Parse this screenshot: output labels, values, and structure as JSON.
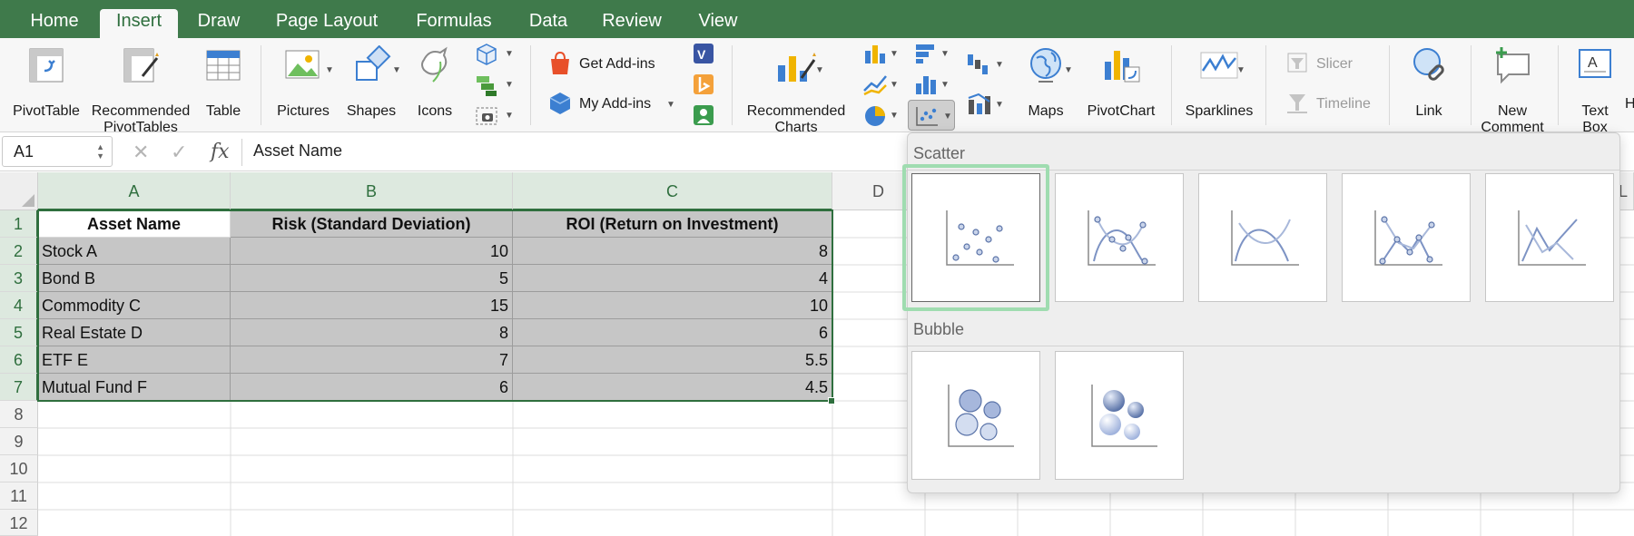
{
  "ribbon_tabs": [
    {
      "label": "Home"
    },
    {
      "label": "Insert",
      "active": true
    },
    {
      "label": "Draw"
    },
    {
      "label": "Page Layout"
    },
    {
      "label": "Formulas"
    },
    {
      "label": "Data"
    },
    {
      "label": "Review"
    },
    {
      "label": "View"
    }
  ],
  "ribbon": {
    "pivottable": "PivotTable",
    "recommended_pivottables": [
      "Recommended",
      "PivotTables"
    ],
    "table": "Table",
    "pictures": "Pictures",
    "shapes": "Shapes",
    "icons": "Icons",
    "get_addins": "Get Add-ins",
    "my_addins": "My Add-ins",
    "recommended_charts": [
      "Recommended",
      "Charts"
    ],
    "maps": "Maps",
    "pivotchart": "PivotChart",
    "sparklines": "Sparklines",
    "slicer": "Slicer",
    "timeline": "Timeline",
    "link": "Link",
    "new_comment": [
      "New",
      "Comment"
    ],
    "text_box": [
      "Text",
      "Box"
    ],
    "cut_off": "H"
  },
  "formula_bar": {
    "name_box": "A1",
    "cancel_icon": "✕",
    "enter_icon": "✓",
    "fx_label": "fx",
    "content": "Asset Name"
  },
  "columns": [
    "A",
    "B",
    "C",
    "D",
    "L"
  ],
  "rows": [
    "1",
    "2",
    "3",
    "4",
    "5",
    "6",
    "7",
    "8",
    "9",
    "10",
    "11",
    "12"
  ],
  "sheet": {
    "header": [
      "Asset Name",
      "Risk (Standard Deviation)",
      "ROI (Return on Investment)"
    ],
    "rows": [
      [
        "Stock A",
        "10",
        "8"
      ],
      [
        "Bond B",
        "5",
        "4"
      ],
      [
        "Commodity C",
        "15",
        "10"
      ],
      [
        "Real Estate D",
        "8",
        "6"
      ],
      [
        "ETF E",
        "7",
        "5.5"
      ],
      [
        "Mutual Fund F",
        "6",
        "4.5"
      ]
    ]
  },
  "gallery": {
    "scatter_title": "Scatter",
    "bubble_title": "Bubble",
    "scatter_items": [
      {
        "name": "scatter-markers-only",
        "selected": true
      },
      {
        "name": "scatter-smooth-lines-markers"
      },
      {
        "name": "scatter-smooth-lines"
      },
      {
        "name": "scatter-straight-lines-markers"
      },
      {
        "name": "scatter-straight-lines"
      }
    ],
    "bubble_items": [
      {
        "name": "bubble"
      },
      {
        "name": "bubble-3d"
      }
    ]
  },
  "colors": {
    "ribbon_green": "#3f7a4b",
    "accent_green": "#2f6f3e",
    "selection_fill": "#c6c6c6",
    "highlight_ring": "#9fdcb0",
    "chart_blue": "#6b84b8"
  }
}
